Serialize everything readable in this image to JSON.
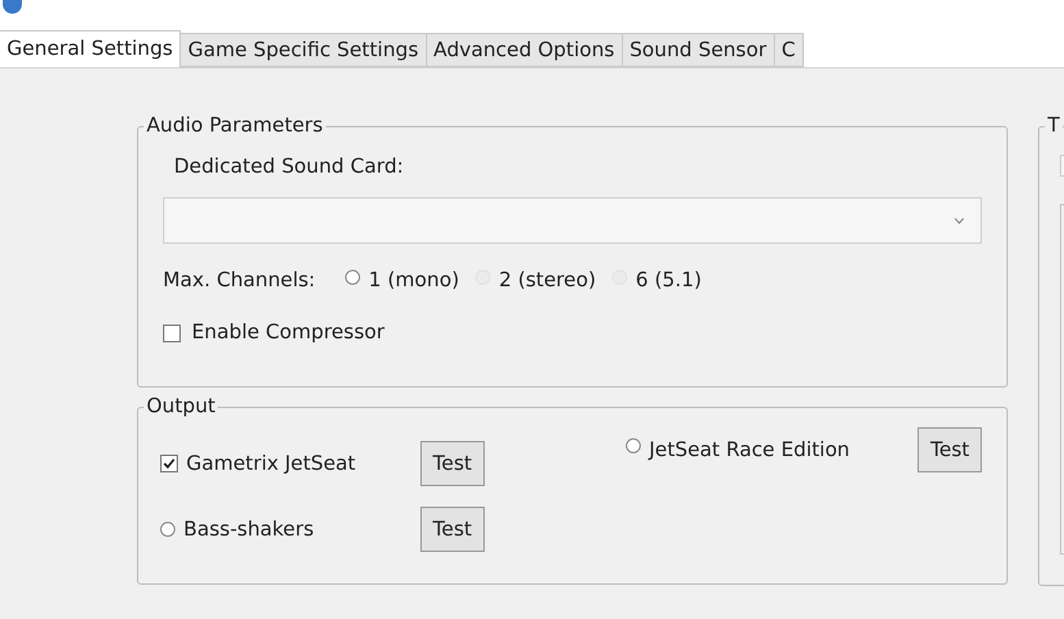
{
  "tabs": [
    {
      "label": "General Settings",
      "selected": true
    },
    {
      "label": "Game Specific Settings",
      "selected": false
    },
    {
      "label": "Advanced Options",
      "selected": false
    },
    {
      "label": "Sound Sensor",
      "selected": false
    },
    {
      "label": "C",
      "selected": false
    }
  ],
  "audio_parameters": {
    "title": "Audio Parameters",
    "sound_card_label": "Dedicated Sound Card:",
    "max_channels_label": "Max. Channels:",
    "channel_options": [
      {
        "label": "1 (mono)",
        "selected": false,
        "disabled": false
      },
      {
        "label": "2 (stereo)",
        "selected": false,
        "disabled": true
      },
      {
        "label": "6 (5.1)",
        "selected": false,
        "disabled": true
      }
    ],
    "compressor": {
      "label": "Enable Compressor",
      "checked": false
    }
  },
  "output": {
    "title": "Output",
    "options": [
      {
        "kind": "checkbox",
        "label": "Gametrix JetSeat",
        "checked": true,
        "button": "Test"
      },
      {
        "kind": "radio",
        "label": "JetSeat Race Edition",
        "selected": false,
        "button": "Test"
      },
      {
        "kind": "radio",
        "label": "Bass-shakers",
        "selected": false,
        "button": "Test"
      }
    ]
  },
  "side_group": {
    "title": "T"
  }
}
